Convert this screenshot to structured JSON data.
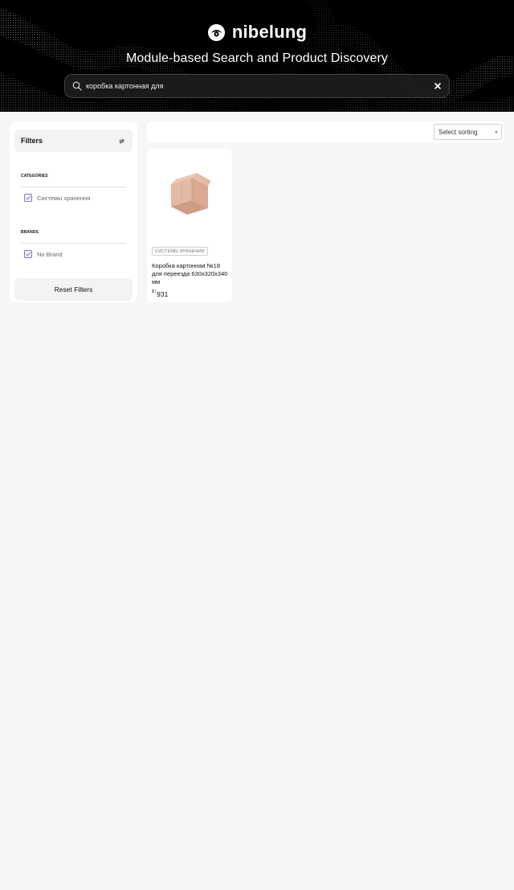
{
  "header": {
    "brand": "nibelung",
    "title": "Module-based Search and Product Discovery",
    "search_value": "коробка картонная для",
    "search_icon": "search-icon",
    "clear_icon": "close-icon"
  },
  "filters": {
    "title": "Filters",
    "refresh_icon": "refresh-icon",
    "sections": [
      {
        "label": "CATEGORIES",
        "options": [
          {
            "label": "Системы хранения",
            "checked": true
          }
        ]
      },
      {
        "label": "BRANDS",
        "options": [
          {
            "label": "No Brand",
            "checked": true
          }
        ]
      }
    ],
    "reset_label": "Reset Filters"
  },
  "toolbar": {
    "sort_label": "Select sorting"
  },
  "products": [
    {
      "category": "СИСТЕМЫ ХРАНЕНИЯ",
      "name": "Коробка картонная №18 для переезда 630x320x340 мм",
      "currency": "$",
      "separator": "/",
      "price": "931"
    }
  ],
  "colors": {
    "accent": "#7a6fd6",
    "hero_bg": "#000000",
    "page_bg": "#f6f6f6"
  }
}
